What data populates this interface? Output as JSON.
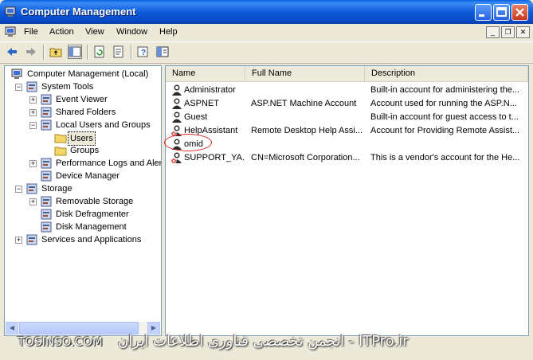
{
  "window": {
    "title": "Computer Management"
  },
  "menu": {
    "items": [
      "File",
      "Action",
      "View",
      "Window",
      "Help"
    ]
  },
  "tree": {
    "nodes": [
      {
        "label": "Computer Management (Local)",
        "icon": "computer-management-icon"
      },
      {
        "label": "System Tools",
        "icon": "system-tools-icon"
      },
      {
        "label": "Event Viewer",
        "icon": "event-viewer-icon"
      },
      {
        "label": "Shared Folders",
        "icon": "shared-folders-icon"
      },
      {
        "label": "Local Users and Groups",
        "icon": "users-groups-icon"
      },
      {
        "label": "Users",
        "icon": "folder-icon"
      },
      {
        "label": "Groups",
        "icon": "folder-icon"
      },
      {
        "label": "Performance Logs and Alerts",
        "icon": "performance-icon"
      },
      {
        "label": "Device Manager",
        "icon": "device-manager-icon"
      },
      {
        "label": "Storage",
        "icon": "storage-icon"
      },
      {
        "label": "Removable Storage",
        "icon": "removable-storage-icon"
      },
      {
        "label": "Disk Defragmenter",
        "icon": "defrag-icon"
      },
      {
        "label": "Disk Management",
        "icon": "disk-management-icon"
      },
      {
        "label": "Services and Applications",
        "icon": "services-icon"
      }
    ]
  },
  "list": {
    "columns": [
      "Name",
      "Full Name",
      "Description"
    ],
    "rows": [
      {
        "name": "Administrator",
        "full_name": "",
        "description": "Built-in account for administering the...",
        "disabled": false
      },
      {
        "name": "ASPNET",
        "full_name": "ASP.NET Machine Account",
        "description": "Account used for running the ASP.N...",
        "disabled": false
      },
      {
        "name": "Guest",
        "full_name": "",
        "description": "Built-in account for guest access to t...",
        "disabled": false
      },
      {
        "name": "HelpAssistant",
        "full_name": "Remote Desktop Help Assi...",
        "description": "Account for Providing Remote Assist...",
        "disabled": true
      },
      {
        "name": "omid",
        "full_name": "",
        "description": "",
        "disabled": false
      },
      {
        "name": "SUPPORT_YA...",
        "full_name": "CN=Microsoft Corporation...",
        "description": "This is a vendor's account for the He...",
        "disabled": true
      }
    ]
  },
  "watermark": {
    "left": "TOSINSO.COM",
    "right": "انجمن تخصصی فناوری اطلاعات ایران - ITPro.ir"
  },
  "colors": {
    "titlebar": "#0a5fe0",
    "annotation_circle": "#d22222"
  }
}
